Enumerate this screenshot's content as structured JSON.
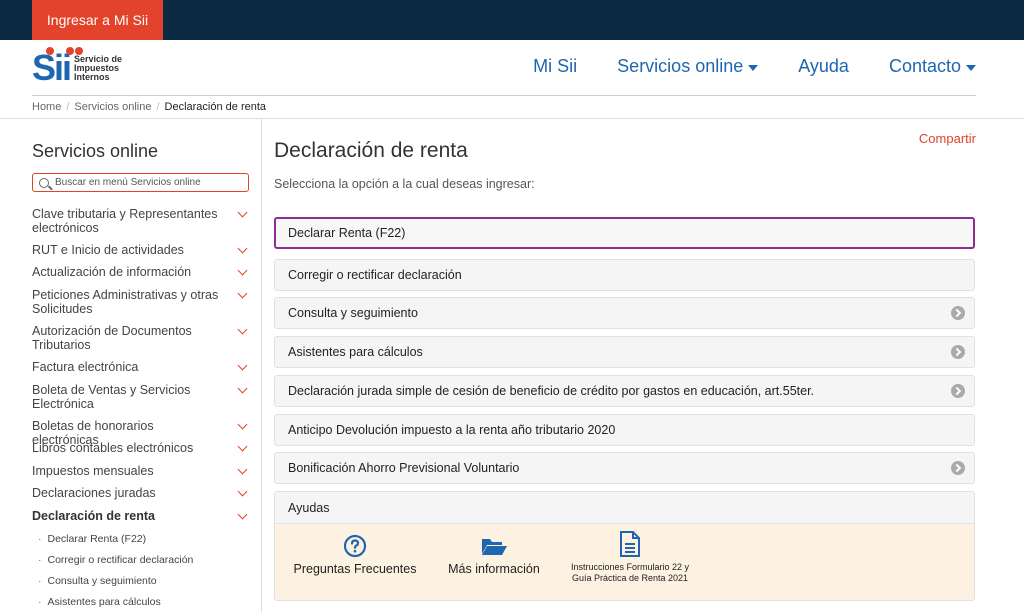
{
  "topbar": {
    "login_label": "Ingresar a Mi Sii"
  },
  "logo": {
    "mark": "Sii",
    "line1": "Servicio de",
    "line2": "Impuestos",
    "line3": "Internos"
  },
  "nav": {
    "mi_sii": "Mi Sii",
    "servicios": "Servicios online",
    "ayuda": "Ayuda",
    "contacto": "Contacto"
  },
  "breadcrumb": {
    "home": "Home",
    "servicios": "Servicios online",
    "current": "Declaración de renta",
    "sep": "/"
  },
  "sidebar": {
    "title": "Servicios online",
    "search_placeholder": "Buscar en menú Servicios online",
    "items": [
      "Clave tributaria y Representantes electrónicos",
      "RUT e Inicio de actividades",
      "Actualización de información",
      "Peticiones Administrativas y otras Solicitudes",
      "Autorización de Documentos Tributarios",
      "Factura electrónica",
      "Boleta de Ventas y Servicios Electrónica",
      "Boletas de honorarios electrónicas",
      "Libros contables electrónicos",
      "Impuestos mensuales",
      "Declaraciones juradas",
      "Declaración de renta"
    ],
    "sub_items": [
      "Declarar Renta (F22)",
      "Corregir o rectificar declaración",
      "Consulta y seguimiento",
      "Asistentes para cálculos"
    ]
  },
  "main": {
    "share": "Compartir",
    "title": "Declaración de renta",
    "subtitle": "Selecciona la opción a la cual deseas ingresar:",
    "options": [
      "Declarar Renta (F22)",
      "Corregir o rectificar declaración",
      "Consulta y seguimiento",
      "Asistentes para cálculos",
      "Declaración jurada simple de cesión de beneficio de crédito por gastos en educación, art.55ter.",
      "Anticipo Devolución impuesto a la renta año tributario 2020",
      "Bonificación Ahorro Previsional Voluntario"
    ],
    "help": {
      "title": "Ayudas",
      "faq": "Preguntas Frecuentes",
      "more": "Más información",
      "instr1": "Instrucciones Formulario 22 y",
      "instr2": "Guía Práctica de Renta 2021"
    }
  },
  "colors": {
    "accent": "#e2432a",
    "brand_blue": "#1e66b2",
    "topbar": "#0c2b42",
    "selected_border": "#8e2d8e"
  }
}
